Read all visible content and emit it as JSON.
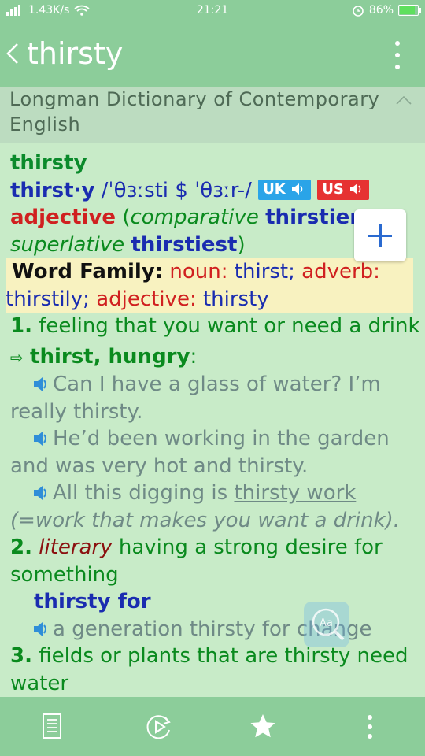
{
  "status": {
    "speed": "1.43K/s",
    "time": "21:21",
    "battery_pct": "86%",
    "battery_level": 0.86
  },
  "appbar": {
    "title": "thirsty",
    "back_icon": "chevron-left-icon",
    "menu_icon": "more-vertical-icon"
  },
  "dictionary": {
    "name_line1": "Longman Dictionary of Contemporary",
    "name_line2": "English"
  },
  "entry": {
    "headword": "thirsty",
    "syllabified": "thirst·y",
    "pron_uk": "/ˈθɜːsti $ ˈθɜːr-/",
    "badge_uk": "UK",
    "badge_us": "US",
    "pos": "adjective",
    "comparative_label": "comparative",
    "comparative": "thirstier,",
    "superlative_label": "superlative",
    "superlative": "thirstiest",
    "word_family_label": "Word Family:",
    "wf_noun_label": "noun:",
    "wf_noun": "thirst;",
    "wf_adverb_label": "adverb:",
    "wf_adverb": "thirstily;",
    "wf_adjective_label": "adjective:",
    "wf_adjective": "thirsty",
    "senses": [
      {
        "num": "1.",
        "def": "feeling that you want or need a drink",
        "related_arrow": "⇨",
        "related": "thirst, hungry",
        "examples": [
          {
            "l1": "Can I have a glass of water? I’m",
            "l2": "really thirsty."
          },
          {
            "l1": "He’d been working in the garden",
            "l2": "and was very hot and thirsty."
          },
          {
            "l1a": "All this digging is ",
            "l1b": "thirsty work",
            "l2": "(=work that makes you want a drink)."
          }
        ]
      },
      {
        "num": "2.",
        "register": "literary",
        "def": "having a strong desire for",
        "def2": "something",
        "collocation": "thirsty for",
        "example": "a generation thirsty for change"
      },
      {
        "num": "3.",
        "def": "fields or plants that are thirsty need",
        "def2": "water"
      }
    ]
  },
  "colors": {
    "appbar": "#8ccd9a",
    "background": "#c8ebc8",
    "headword": "#0b8a2b",
    "keyword_blue": "#1a2cb0",
    "label_red": "#d02020",
    "wordfamily_bg": "#f8f2c0"
  },
  "bottombar": {
    "icons": [
      "document-list-icon",
      "play-cycle-icon",
      "star-icon",
      "more-vertical-icon"
    ]
  }
}
